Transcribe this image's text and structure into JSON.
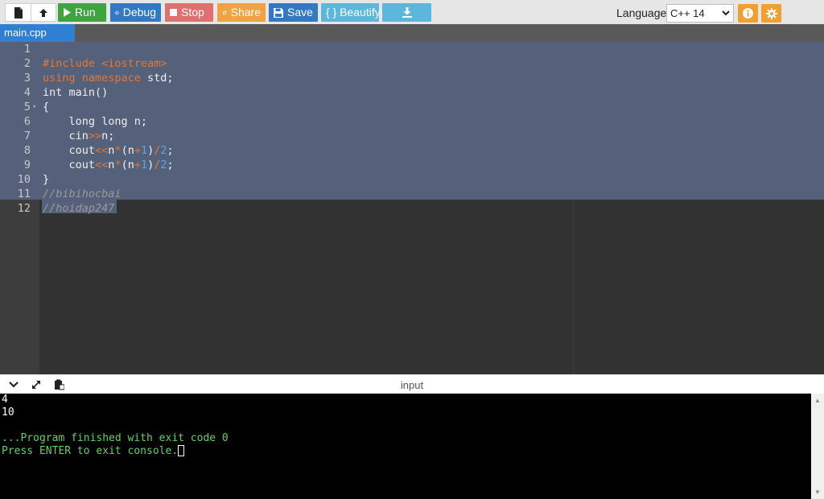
{
  "toolbar": {
    "run": "Run",
    "debug": "Debug",
    "stop": "Stop",
    "share": "Share",
    "save": "Save",
    "beautify": "{ } Beautify",
    "language_label": "Language",
    "language_value": "C++ 14",
    "colors": {
      "run": "#3fa33f",
      "debug": "#3179c4",
      "stop": "#e0706f",
      "share": "#f2a341",
      "save": "#3179c4",
      "beautify": "#5bb7db",
      "download": "#5bb7db",
      "info": "#f0a030",
      "settings": "#f0a030"
    }
  },
  "tab": {
    "name": "main.cpp"
  },
  "editor": {
    "lines": [
      {
        "n": "1",
        "text": ""
      },
      {
        "n": "2",
        "text": "#include <iostream>"
      },
      {
        "n": "3",
        "text": "using namespace std;"
      },
      {
        "n": "4",
        "text": "int main()"
      },
      {
        "n": "5",
        "text": "{"
      },
      {
        "n": "6",
        "text": "    long long n;"
      },
      {
        "n": "7",
        "text": "    cin>>n;"
      },
      {
        "n": "8",
        "text": "    cout<<n*(n+1)/2;"
      },
      {
        "n": "9",
        "text": "    cout<<n*(n+1)/2;"
      },
      {
        "n": "10",
        "text": "}"
      },
      {
        "n": "11",
        "text": "//bibihocbai"
      },
      {
        "n": "12",
        "text": "//hoidap247"
      }
    ]
  },
  "console": {
    "input_label": "input",
    "output": [
      "4",
      "10",
      "",
      "...Program finished with exit code 0",
      "Press ENTER to exit console."
    ]
  }
}
